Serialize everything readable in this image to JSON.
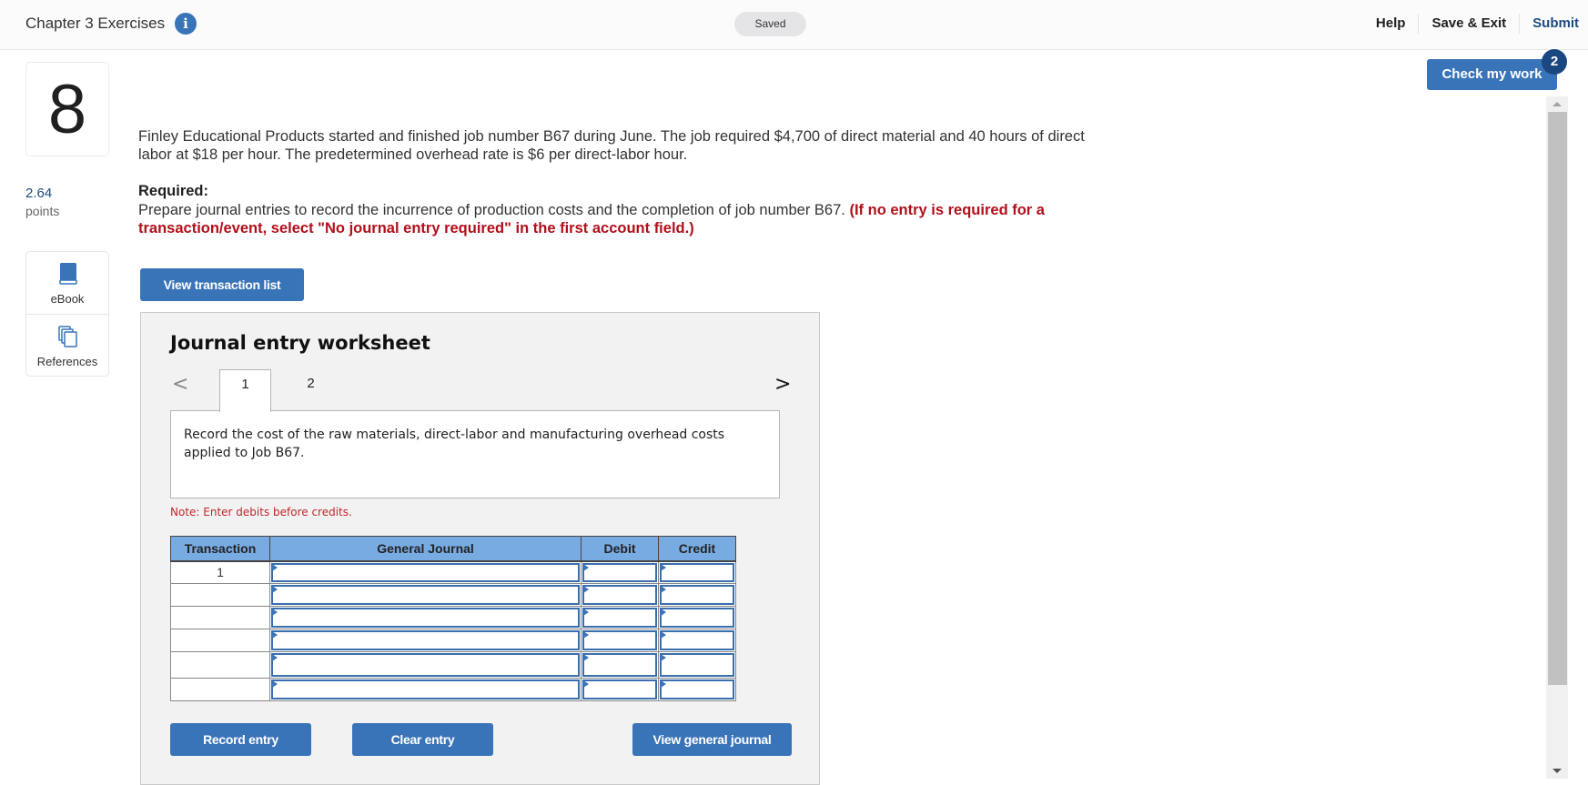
{
  "header": {
    "title": "Chapter 3 Exercises",
    "info_icon": "info-icon",
    "status": "Saved",
    "links": {
      "help": "Help",
      "save_exit": "Save & Exit",
      "submit": "Submit"
    }
  },
  "check_work": {
    "label": "Check my work",
    "badge": "2"
  },
  "question": {
    "number": "8",
    "points_value": "2.64",
    "points_label": "points",
    "text": "Finley Educational Products started and finished job number B67 during June. The job required $4,700 of direct material and 40 hours of direct labor at $18 per hour. The predetermined overhead rate is $6 per direct-labor hour.",
    "required_title": "Required:",
    "required_text": "Prepare journal entries to record the incurrence of production costs and the completion of job number B67. ",
    "required_note": "(If no entry is required for a transaction/event, select \"No journal entry required\" in the first account field.)"
  },
  "tools": [
    {
      "label": "eBook",
      "icon": "book-icon"
    },
    {
      "label": "References",
      "icon": "references-icon"
    }
  ],
  "view_transaction_list": "View transaction list",
  "worksheet": {
    "title": "Journal entry worksheet",
    "tabs": [
      "1",
      "2"
    ],
    "active_tab": "1",
    "description": "Record the cost of the raw materials, direct-labor and manufacturing overhead costs applied to Job B67.",
    "note": "Note: Enter debits before credits.",
    "table": {
      "columns": [
        "Transaction",
        "General Journal",
        "Debit",
        "Credit"
      ],
      "rows": [
        {
          "transaction": "1",
          "account": "",
          "debit": "",
          "credit": ""
        },
        {
          "transaction": "",
          "account": "",
          "debit": "",
          "credit": ""
        },
        {
          "transaction": "",
          "account": "",
          "debit": "",
          "credit": ""
        },
        {
          "transaction": "",
          "account": "",
          "debit": "",
          "credit": ""
        },
        {
          "transaction": "",
          "account": "",
          "debit": "",
          "credit": ""
        },
        {
          "transaction": "",
          "account": "",
          "debit": "",
          "credit": ""
        }
      ]
    },
    "buttons": {
      "record": "Record entry",
      "clear": "Clear entry",
      "view_journal": "View general journal"
    }
  },
  "colors": {
    "accent": "#3a74b8",
    "badge": "#1b4780",
    "alert_red": "#b0101b",
    "table_header": "#79abe3"
  }
}
